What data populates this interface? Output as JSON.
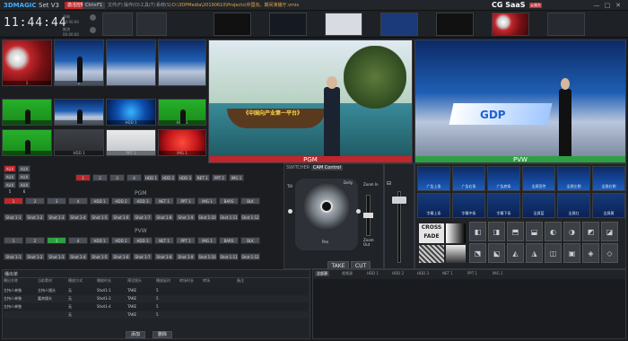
{
  "app": {
    "brand_main": "3DMAGIC",
    "brand_ver": "Set V3",
    "badge_license": "激活控制",
    "badge_ctrl": "Ctrl+F1",
    "menu": [
      "文件(F)",
      "操作(O)",
      "工具(T)",
      "系统(S)"
    ],
    "file_path": "D:\\3DPMedia\\20190610\\Projects\\中国向。期间演播厅.vmix",
    "cgsaas": "CG SaaS",
    "cgsaas_sub": "云服务",
    "window_buttons": [
      "—",
      "□",
      "✕"
    ]
  },
  "clock": {
    "time": "11:44:44",
    "rec_labels": [
      "录制",
      "推流"
    ],
    "rec_times": [
      "00:00:00",
      "00:00:00"
    ]
  },
  "source_thumbs": {
    "labels": [
      "1",
      "2",
      "3",
      "4",
      "5",
      "6",
      "7",
      "8"
    ]
  },
  "preview_grid": {
    "tiles": [
      {
        "label": "1",
        "style": "red-studio"
      },
      {
        "label": "2",
        "style": "studio"
      },
      {
        "label": "3",
        "style": "green"
      },
      {
        "label": "4",
        "style": "studio"
      },
      {
        "label": "HDD 1",
        "style": "blue"
      },
      {
        "label": "HDD 2",
        "style": "green"
      },
      {
        "label": "5",
        "style": "green"
      },
      {
        "label": "HDD 3",
        "style": "gray"
      },
      {
        "label": "PPT 1",
        "style": "whitebar"
      },
      {
        "label": "IMG 1",
        "style": "red"
      }
    ]
  },
  "monitors": {
    "pgm_label": "PGM",
    "pvw_label": "PVW",
    "pgm_banner": "《中国向产业第一平台》",
    "pvw_banner": "GDP"
  },
  "switcher": {
    "aux_buttons": [
      "AUX 1",
      "AUX 2",
      "AUX 3",
      "AUX 4",
      "AUX 5",
      "AUX 6"
    ],
    "top_row": [
      "1",
      "2",
      "3",
      "4",
      "HDD 1",
      "HDD 2",
      "HDD 3",
      "NET 1",
      "PPT 1",
      "IMG 1"
    ],
    "pgm_title": "PGM",
    "pvw_title": "PVW",
    "pgm_row": [
      "1",
      "2",
      "3",
      "4",
      "HDD 1",
      "HDD 2",
      "HDD 3",
      "NET 1",
      "PPT 1",
      "IMG 1",
      "BARS",
      "BLK"
    ],
    "pgm_shot_row": [
      "Shot 1-1",
      "Shot 1-2",
      "Shot 1-3",
      "Shot 1-4",
      "Shot 1-5",
      "Shot 1-6",
      "Shot 1-7",
      "Shot 1-8",
      "Shot 1-9",
      "Shot 1-10",
      "Shot 1-11",
      "Shot 1-12"
    ],
    "pvw_row": [
      "1",
      "2",
      "3",
      "4",
      "HDD 1",
      "HDD 2",
      "HDD 3",
      "NET 1",
      "PPT 1",
      "IMG 1",
      "BARS",
      "BLK"
    ],
    "pvw_shot_row": [
      "Shot 1-1",
      "Shot 1-2",
      "Shot 1-3",
      "Shot 1-4",
      "Shot 1-5",
      "Shot 1-6",
      "Shot 1-7",
      "Shot 1-8",
      "Shot 1-9",
      "Shot 1-10",
      "Shot 1-11",
      "Shot 1-12"
    ],
    "pgm_active_index": 0,
    "pvw_active_index": 2
  },
  "cam_control": {
    "tab_switcher": "SWITCHER",
    "tab_cam": "CAM Control",
    "dolly": "Dolly",
    "zoom_in": "Zoom In",
    "zoom_out": "Zoom Out",
    "tilt": "Tilt",
    "pan": "Pan",
    "take": "TAKE",
    "cut": "CUT"
  },
  "effects": {
    "crossfade": "CROSS FADE",
    "mini_labels": [
      "广告上条",
      "广告右条",
      "广告底条",
      "全屏宣传",
      "全屏左侧",
      "全屏右侧",
      "字幕上条",
      "字幕中条",
      "字幕下条",
      "全屏蓝",
      "全屏红",
      "全屏黄"
    ]
  },
  "table": {
    "title": "播出单",
    "columns": [
      "播出名称",
      "当前素材",
      "播放方式",
      "播放时长",
      "预设镜头",
      "播放延时",
      "转场时长",
      "转场",
      "备注"
    ],
    "rows": [
      [
        "主持人单独",
        "主持人镜头",
        "无",
        "Shot1-1",
        "TAKE",
        "5"
      ],
      [
        "主持人单独",
        "嘉宾镜头",
        "无",
        "Shot1-2",
        "TAKE",
        "5"
      ],
      [
        "主持人单独",
        "",
        "无",
        "Shot1-4",
        "TAKE",
        "5"
      ],
      [
        "",
        "",
        "无",
        "",
        "TAKE",
        "5"
      ]
    ],
    "footer_buttons": [
      "添加",
      "删除"
    ],
    "source_tabs": [
      "全部源",
      "视频源",
      "HDD 1",
      "HDD 2",
      "HDD 3",
      "NET 1",
      "PPT 1",
      "IMG 1"
    ]
  },
  "colors": {
    "accent_blue": "#3fb0ff",
    "pgm_red": "#c0262a",
    "pvw_green": "#2ea043"
  }
}
